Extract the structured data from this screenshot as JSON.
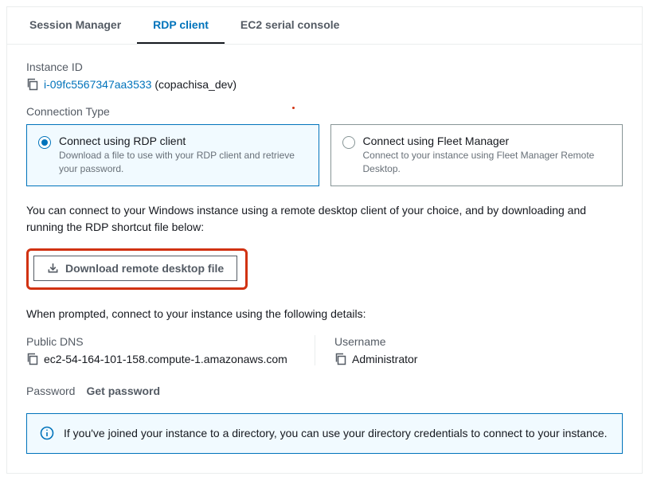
{
  "tabs": {
    "session_manager": "Session Manager",
    "rdp_client": "RDP client",
    "ec2_serial": "EC2 serial console"
  },
  "instance": {
    "label": "Instance ID",
    "id": "i-09fc5567347aa3533",
    "name_suffix": " (copachisa_dev)"
  },
  "connection_type": {
    "label": "Connection Type",
    "option_rdp": {
      "title": "Connect using RDP client",
      "desc": "Download a file to use with your RDP client and retrieve your password."
    },
    "option_fleet": {
      "title": "Connect using Fleet Manager",
      "desc": "Connect to your instance using Fleet Manager Remote Desktop."
    }
  },
  "intro_text": "You can connect to your Windows instance using a remote desktop client of your choice, and by downloading and running the RDP shortcut file below:",
  "download_button": "Download remote desktop file",
  "prompt_text": "When prompted, connect to your instance using the following details:",
  "public_dns": {
    "label": "Public DNS",
    "value": "ec2-54-164-101-158.compute-1.amazonaws.com"
  },
  "username": {
    "label": "Username",
    "value": "Administrator"
  },
  "password": {
    "label": "Password",
    "get": "Get password"
  },
  "info_text": "If you've joined your instance to a directory, you can use your directory credentials to connect to your instance."
}
